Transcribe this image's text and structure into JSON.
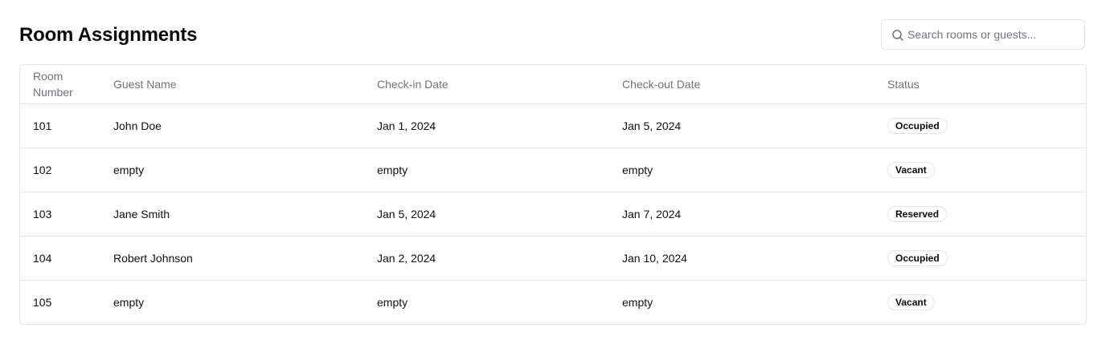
{
  "header": {
    "title": "Room Assignments"
  },
  "search": {
    "placeholder": "Search rooms or guests...",
    "value": "",
    "icon": "search-icon"
  },
  "table": {
    "columns": [
      "Room Number",
      "Guest Name",
      "Check-in Date",
      "Check-out Date",
      "Status"
    ],
    "rows": [
      {
        "room": "101",
        "guest": "John Doe",
        "check_in": "Jan 1, 2024",
        "check_out": "Jan 5, 2024",
        "status": "Occupied"
      },
      {
        "room": "102",
        "guest": "empty",
        "check_in": "empty",
        "check_out": "empty",
        "status": "Vacant"
      },
      {
        "room": "103",
        "guest": "Jane Smith",
        "check_in": "Jan 5, 2024",
        "check_out": "Jan 7, 2024",
        "status": "Reserved"
      },
      {
        "room": "104",
        "guest": "Robert Johnson",
        "check_in": "Jan 2, 2024",
        "check_out": "Jan 10, 2024",
        "status": "Occupied"
      },
      {
        "room": "105",
        "guest": "empty",
        "check_in": "empty",
        "check_out": "empty",
        "status": "Vacant"
      }
    ]
  },
  "colors": {
    "border": "#e4e4e7",
    "muted_text": "#71717a",
    "text": "#111111"
  }
}
